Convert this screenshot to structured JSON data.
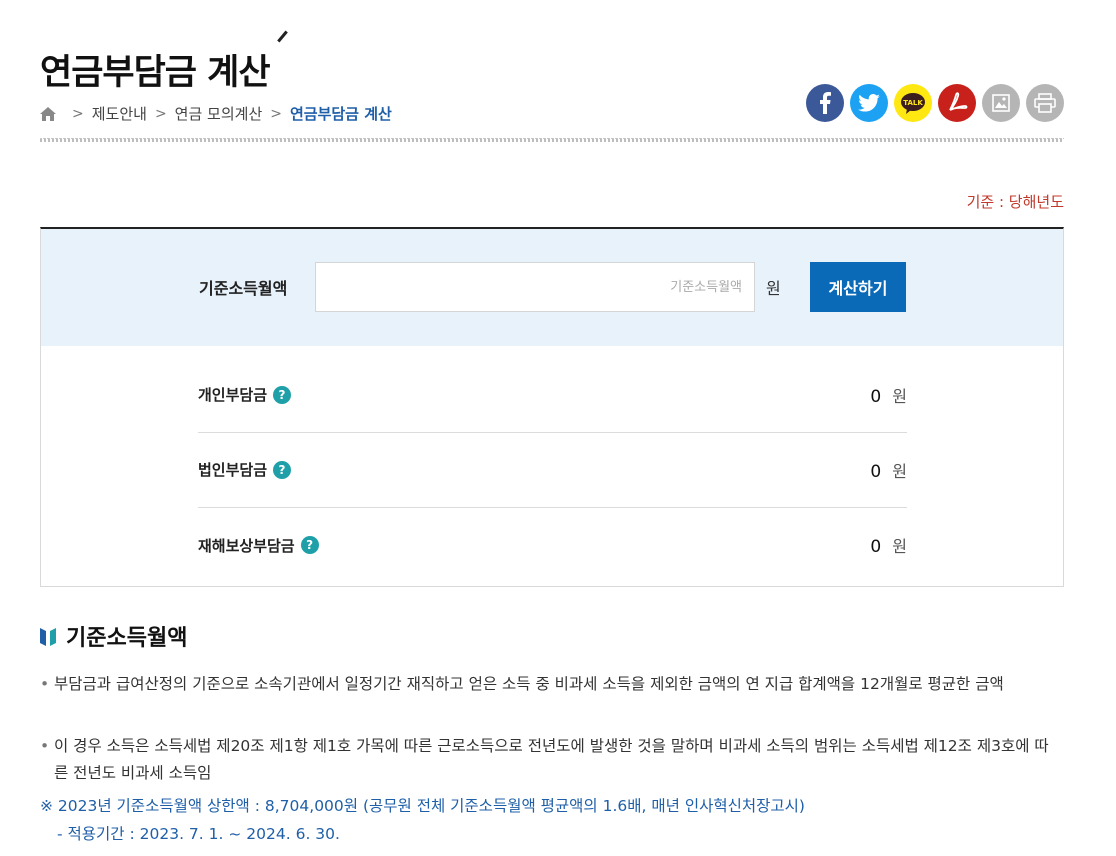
{
  "page": {
    "title": "연금부담금 계산",
    "basis": "기준 : 당해년도"
  },
  "breadcrumb": {
    "items": [
      "제도안내",
      "연금 모의계산",
      "연금부담금 계산"
    ],
    "separator": ">"
  },
  "share": {
    "buttons": [
      {
        "name": "facebook",
        "color": "#3b5998",
        "glyph": "f"
      },
      {
        "name": "twitter",
        "color": "#1da1f2",
        "glyph": "t"
      },
      {
        "name": "kakaotalk",
        "color": "#ffe812",
        "glyph": "TALK"
      },
      {
        "name": "pdf",
        "color": "#c8201a",
        "glyph": "pdf"
      },
      {
        "name": "image",
        "color": "#b5b5b5",
        "glyph": "img"
      },
      {
        "name": "print",
        "color": "#b5b5b5",
        "glyph": "print"
      }
    ]
  },
  "form": {
    "label": "기준소득월액",
    "value": "",
    "placeholder": "기준소득월액",
    "unit": "원",
    "button_label": "계산하기"
  },
  "results": [
    {
      "label": "개인부담금",
      "help": "?",
      "value": "0",
      "unit": "원"
    },
    {
      "label": "법인부담금",
      "help": "?",
      "value": "0",
      "unit": "원"
    },
    {
      "label": "재해보상부담금",
      "help": "?",
      "value": "0",
      "unit": "원"
    }
  ],
  "section": {
    "title": "기준소득월액",
    "bullet_marker": "•",
    "items": [
      "부담금과 급여산정의 기준으로 소속기관에서 일정기간 재직하고 얻은 소득 중 비과세 소득을 제외한 금액의 연 지급 합계액을 12개월로 평균한 금액",
      "이 경우 소득은 소득세법 제20조 제1항 제1호 가목에 따른 근로소득으로 전년도에 발생한 것을 말하며 비과세 소득의 범위는 소득세법 제12조 제3호에 따른 전년도 비과세 소득임"
    ],
    "note_line1": "※ 2023년 기준소득월액 상한액 : 8,704,000원 (공무원 전체 기준소득월액 평균액의 1.6배, 매년 인사혁신처장고시)",
    "note_line2": "- 적용기간 : 2023. 7. 1. ~ 2024. 6. 30."
  },
  "colors": {
    "accent_blue": "#0a6ab8",
    "breadcrumb_current": "#1f5fa8",
    "basis_red": "#c0392b",
    "input_band": "#e8f2fb",
    "help_teal": "#1fa0a8"
  }
}
